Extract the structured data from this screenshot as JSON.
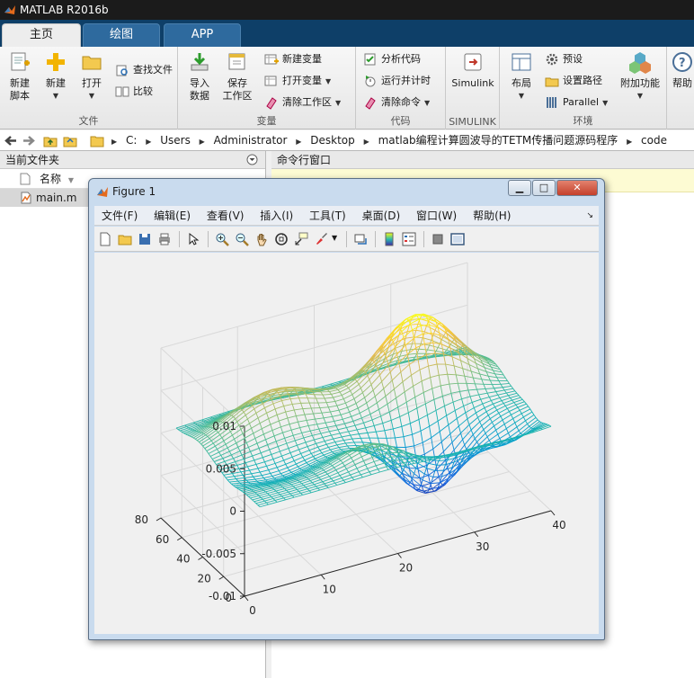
{
  "app": {
    "title": "MATLAB R2016b"
  },
  "tabs": [
    {
      "label": "主页",
      "active": true
    },
    {
      "label": "绘图",
      "active": false
    },
    {
      "label": "APP",
      "active": false
    }
  ],
  "ribbon": {
    "file": {
      "label": "文件",
      "new_script": {
        "line1": "新建",
        "line2": "脚本"
      },
      "new": "新建",
      "open": "打开",
      "find_files": "查找文件",
      "compare": "比较"
    },
    "variable": {
      "label": "变量",
      "import": {
        "line1": "导入",
        "line2": "数据"
      },
      "save": {
        "line1": "保存",
        "line2": "工作区"
      },
      "new_variable": "新建变量",
      "open_variable": "打开变量",
      "clear_workspace": "清除工作区"
    },
    "code": {
      "label": "代码",
      "analyze": "分析代码",
      "run_time": "运行并计时",
      "clear_commands": "清除命令"
    },
    "simulink": {
      "label": "SIMULINK",
      "button": "Simulink"
    },
    "environment": {
      "label": "环境",
      "layout": "布局",
      "preferences": "预设",
      "set_path": "设置路径",
      "parallel": "Parallel",
      "addons": "附加功能"
    },
    "help": "帮助"
  },
  "address": {
    "segments": [
      "C:",
      "Users",
      "Administrator",
      "Desktop",
      "matlab编程计算圆波导的TETM传播问题源码程序",
      "code"
    ]
  },
  "current_folder": {
    "title": "当前文件夹",
    "column": "名称",
    "files": [
      "main.m"
    ]
  },
  "command_window": {
    "title": "命令行窗口"
  },
  "figure": {
    "title": "Figure 1",
    "menu": [
      "文件(F)",
      "编辑(E)",
      "查看(V)",
      "插入(I)",
      "工具(T)",
      "桌面(D)",
      "窗口(W)",
      "帮助(H)"
    ],
    "chart_data": {
      "type": "mesh",
      "x_ticks": [
        "0",
        "10",
        "20",
        "30",
        "40"
      ],
      "y_ticks": [
        "0",
        "20",
        "40",
        "60",
        "80"
      ],
      "z_ticks": [
        "-0.01",
        "-0.005",
        "0",
        "0.005",
        "0.01"
      ],
      "xlim": [
        0,
        40
      ],
      "ylim": [
        0,
        80
      ],
      "zlim": [
        -0.01,
        0.01
      ],
      "grid": true,
      "colormap": "parula"
    }
  }
}
